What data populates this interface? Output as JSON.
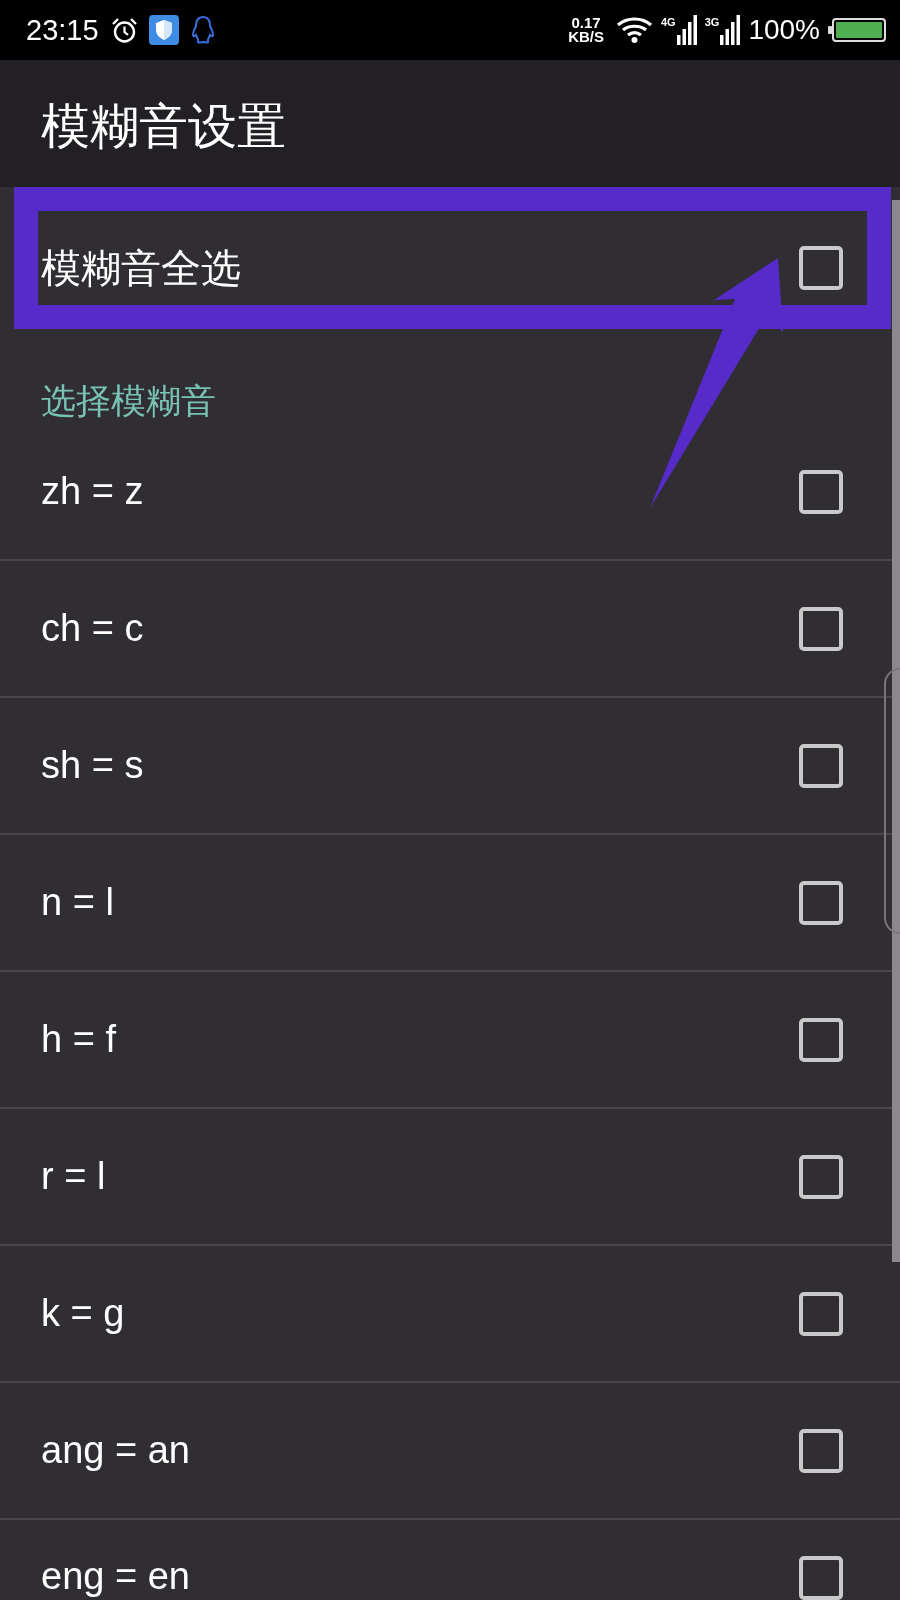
{
  "status_bar": {
    "time": "23:15",
    "net_speed": "0.17",
    "net_speed_unit": "KB/S",
    "signal_labels": [
      "4G",
      "3G"
    ],
    "battery": "100%"
  },
  "app_bar": {
    "title": "模糊音设置"
  },
  "select_all": {
    "label": "模糊音全选",
    "checked": false
  },
  "section_header": "选择模糊音",
  "options": [
    {
      "label": "zh = z",
      "checked": false
    },
    {
      "label": "ch = c",
      "checked": false
    },
    {
      "label": "sh = s",
      "checked": false
    },
    {
      "label": "n = l",
      "checked": false
    },
    {
      "label": "h = f",
      "checked": false
    },
    {
      "label": "r = l",
      "checked": false
    },
    {
      "label": "k = g",
      "checked": false
    },
    {
      "label": "ang = an",
      "checked": false
    },
    {
      "label": "eng = en",
      "checked": false
    }
  ],
  "annotations": {
    "highlight_frame": true,
    "pointer_arrow": true
  }
}
